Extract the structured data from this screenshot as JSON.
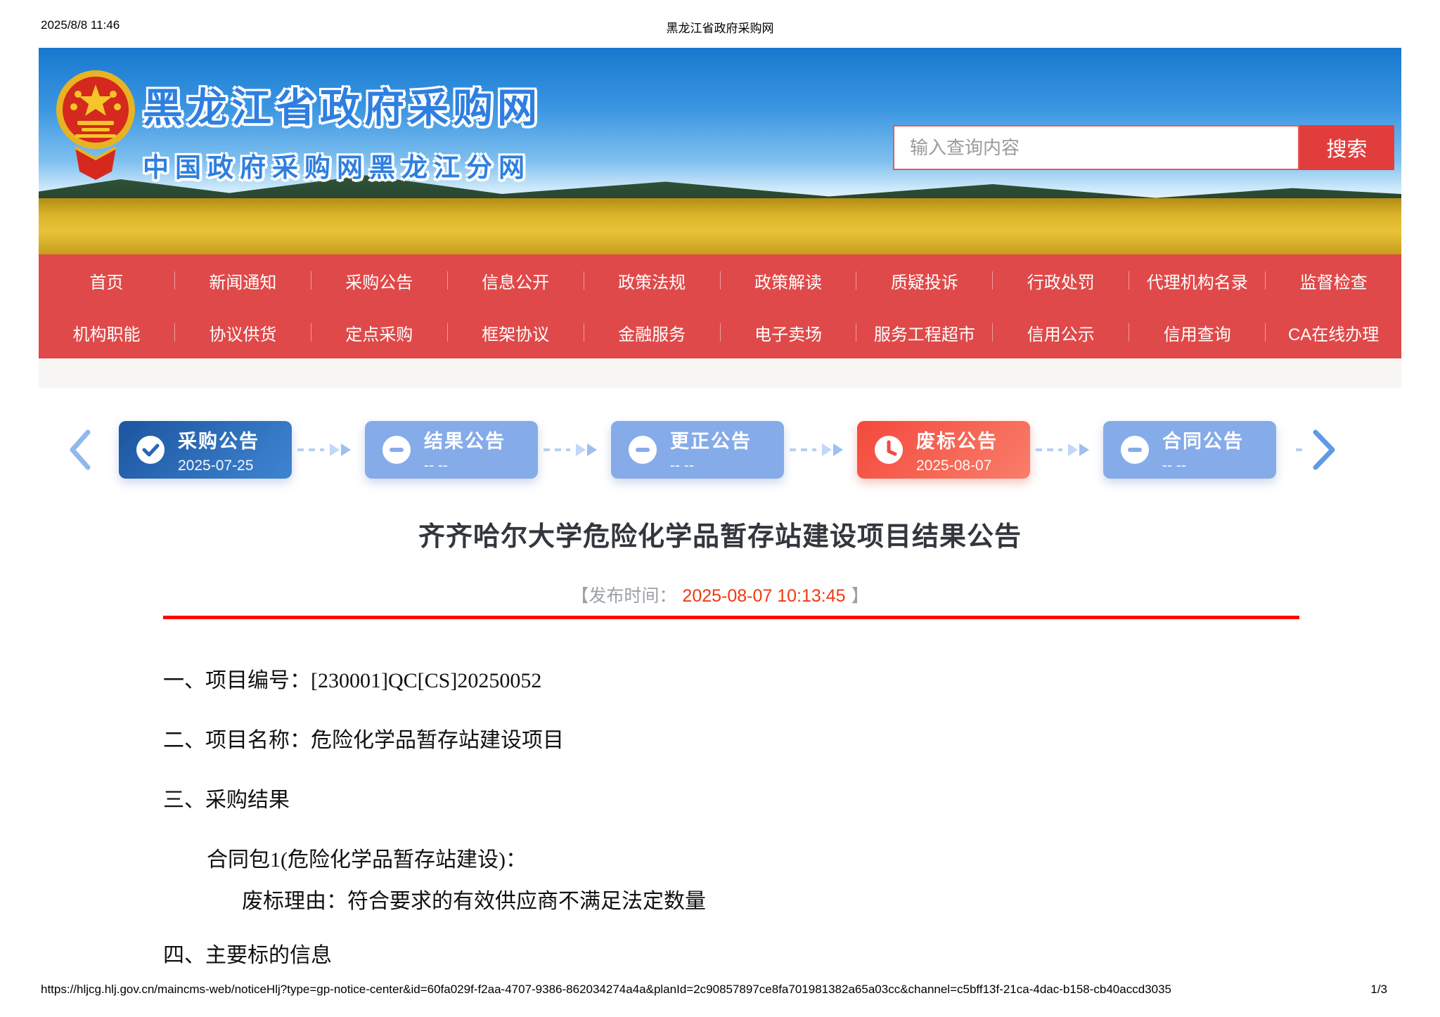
{
  "print_header": {
    "datetime": "2025/8/8 11:46",
    "doc_title": "黑龙江省政府采购网"
  },
  "banner": {
    "emblem_icon": "china-national-emblem-icon",
    "site_title": "黑龙江省政府采购网",
    "site_subtitle": "中国政府采购网黑龙江分网",
    "search": {
      "placeholder": "输入查询内容",
      "value": "",
      "button_label": "搜索"
    }
  },
  "nav": {
    "row1": [
      "首页",
      "新闻通知",
      "采购公告",
      "信息公开",
      "政策法规",
      "政策解读",
      "质疑投诉",
      "行政处罚",
      "代理机构名录",
      "监督检查"
    ],
    "row2": [
      "机构职能",
      "协议供货",
      "定点采购",
      "框架协议",
      "金融服务",
      "电子卖场",
      "服务工程超市",
      "信用公示",
      "信用查询",
      "CA在线办理"
    ]
  },
  "timeline": {
    "steps": [
      {
        "label": "采购公告",
        "date": "2025-07-25",
        "state": "done",
        "icon": "check-circle-icon"
      },
      {
        "label": "结果公告",
        "date": "-- --",
        "state": "pending",
        "icon": "minus-circle-icon"
      },
      {
        "label": "更正公告",
        "date": "-- --",
        "state": "pending",
        "icon": "minus-circle-icon"
      },
      {
        "label": "废标公告",
        "date": "2025-08-07",
        "state": "void",
        "icon": "clock-icon"
      },
      {
        "label": "合同公告",
        "date": "-- --",
        "state": "pending",
        "icon": "minus-circle-icon"
      }
    ]
  },
  "article": {
    "title": "齐齐哈尔大学危险化学品暂存站建设项目结果公告",
    "publish_prefix": "【发布时间：",
    "publish_datetime": "2025-08-07 10:13:45",
    "publish_suffix": "】",
    "lines": [
      {
        "text": "一、项目编号：[230001]QC[CS]20250052",
        "indent": 0
      },
      {
        "text": "二、项目名称：危险化学品暂存站建设项目",
        "indent": 0
      },
      {
        "text": "三、采购结果",
        "indent": 0
      },
      {
        "text": "合同包1(危险化学品暂存站建设)：",
        "indent": 1
      },
      {
        "text": "废标理由：符合要求的有效供应商不满足法定数量",
        "indent": 2
      },
      {
        "text": "四、主要标的信息",
        "indent": 0
      }
    ]
  },
  "footer": {
    "url": "https://hljcg.hlj.gov.cn/maincms-web/noticeHlj?type=gp-notice-center&id=60fa029f-f2aa-4707-9386-862034274a4a&planId=2c90857897ce8fa701981382a65a03cc&channel=c5bff13f-21ca-4dac-b158-cb40accd3035",
    "page_indicator": "1/3"
  },
  "colors": {
    "nav_red": "#e04949",
    "search_button_red": "#e23d3d",
    "band_gray": "#f7f6f4",
    "step_done_blue_1": "#1c55a0",
    "step_done_blue_2": "#3f85d2",
    "step_pending_blue": "#85abe9",
    "step_void_red_1": "#f4493c",
    "step_void_red_2": "#f97e6a",
    "arrow_blue": "#a9c7f0",
    "title_dark": "#32373e",
    "publish_gray": "#9aa0a8",
    "publish_red": "#ef3a10",
    "divider_red": "#fe0101"
  }
}
